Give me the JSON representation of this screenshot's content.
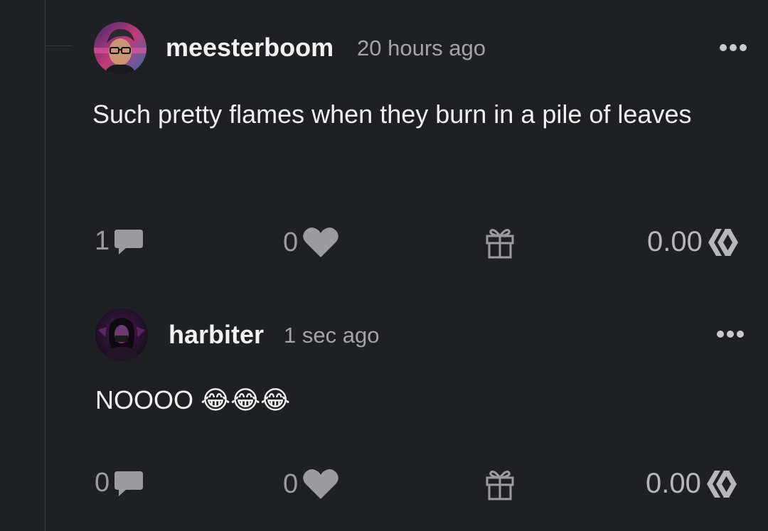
{
  "comments": [
    {
      "username": "meesterboom",
      "time": "20 hours ago",
      "body": "Such pretty flames when they burn in a pile of leaves",
      "replies": "1",
      "votes": "0",
      "payout": "0.00"
    },
    {
      "username": "harbiter",
      "time": "1 sec ago",
      "body": "NOOOO 😂😂😂",
      "replies": "0",
      "votes": "0",
      "payout": "0.00"
    }
  ],
  "icons": {
    "reply": "speech-bubble",
    "vote": "heart",
    "gift": "gift",
    "payout": "hive-logo",
    "more": "ellipsis"
  },
  "colors": {
    "background": "#1f2023",
    "text": "#f0f0f0",
    "muted": "#a4a4a8",
    "icon": "#9c9c9f"
  }
}
